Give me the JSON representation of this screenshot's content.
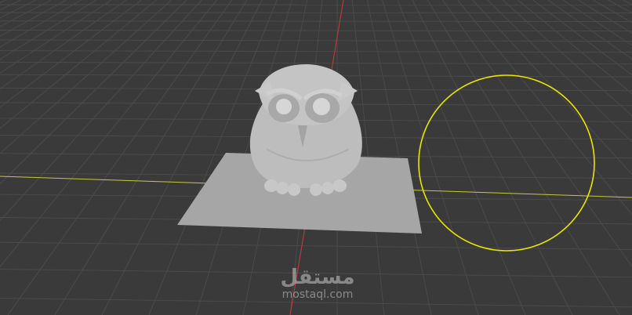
{
  "viewport": {
    "background_color": "#3a3a3a",
    "grid_color": "#4a4a4a",
    "x_axis_color": "#c8c83a",
    "y_axis_color": "#b33a3a",
    "brush_circle_color": "#e6e600",
    "object_name": "owl-sculpt",
    "plane_color": "#a6a6a6",
    "owl_color": "#bdbdbd"
  },
  "watermark": {
    "arabic_text": "مستقل",
    "latin_text": "mostaql.com"
  }
}
